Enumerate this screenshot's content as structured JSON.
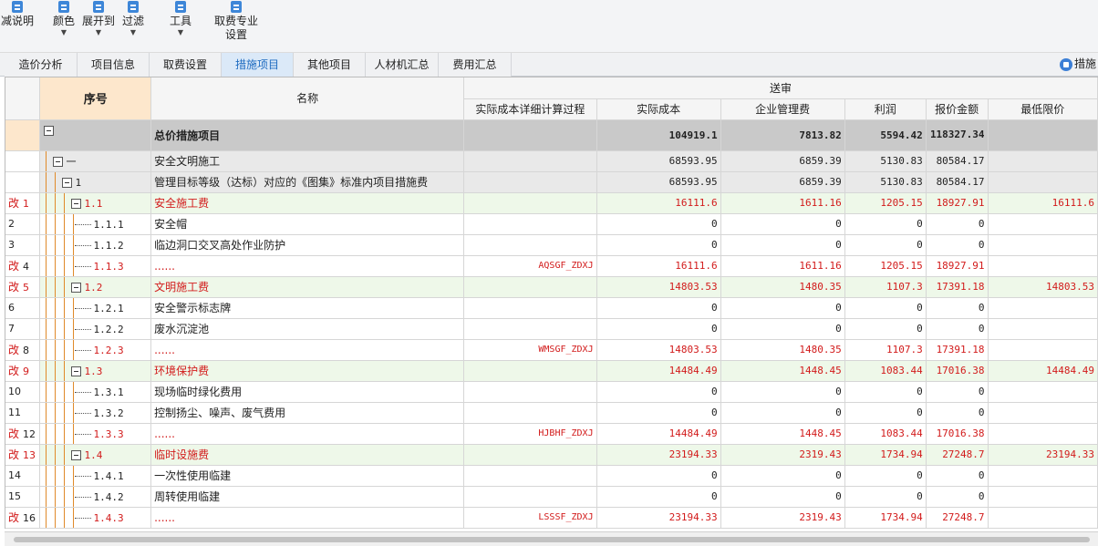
{
  "toolbar": {
    "items": [
      {
        "label": "减说明",
        "icon": "list-icon",
        "caret": false
      },
      {
        "label": "颜色",
        "icon": "paint-icon",
        "caret": true
      },
      {
        "label": "展开到",
        "icon": "expand-icon",
        "caret": true
      },
      {
        "label": "过滤",
        "icon": "filter-icon",
        "caret": true
      },
      {
        "label": "工具",
        "icon": "tool-icon",
        "caret": true
      },
      {
        "label": "取费专业\n设置",
        "icon": "fee-settings-icon",
        "caret": false
      }
    ]
  },
  "tabs": [
    "造价分析",
    "项目信息",
    "取费设置",
    "措施项目",
    "其他项目",
    "人材机汇总",
    "费用汇总"
  ],
  "active_tab": "措施项目",
  "tab_right_label": "措施",
  "grid": {
    "headers": {
      "seq": "序号",
      "name": "名称",
      "group": "送审",
      "cols": [
        "实际成本详细计算过程",
        "实际成本",
        "企业管理费",
        "利润",
        "报价金额",
        "最低限价"
      ]
    },
    "change_mark": "改",
    "rows": [
      {
        "rn": "",
        "seq": "",
        "name": "总价措施项目",
        "code": "",
        "cost": "104919.1",
        "mgmt": "7813.82",
        "profit": "5594.42",
        "quote": "118327.34",
        "min": "",
        "kind": "lv0",
        "depth": 0,
        "changed": false
      },
      {
        "rn": "",
        "seq": "一",
        "name": "安全文明施工",
        "code": "",
        "cost": "68593.95",
        "mgmt": "6859.39",
        "profit": "5130.83",
        "quote": "80584.17",
        "min": "",
        "kind": "lv1",
        "depth": 1,
        "changed": false
      },
      {
        "rn": "",
        "seq": "1",
        "name": "管理目标等级（达标）对应的《图集》标准内项目措施费",
        "code": "",
        "cost": "68593.95",
        "mgmt": "6859.39",
        "profit": "5130.83",
        "quote": "80584.17",
        "min": "",
        "kind": "lv2",
        "depth": 2,
        "changed": false
      },
      {
        "rn": "1",
        "seq": "1.1",
        "name": "安全施工费",
        "code": "",
        "cost": "16111.6",
        "mgmt": "1611.16",
        "profit": "1205.15",
        "quote": "18927.91",
        "min": "16111.6",
        "kind": "grp",
        "depth": 3,
        "changed": true
      },
      {
        "rn": "2",
        "seq": "1.1.1",
        "name": "安全帽",
        "code": "",
        "cost": "0",
        "mgmt": "0",
        "profit": "0",
        "quote": "0",
        "min": "",
        "kind": "leaf",
        "depth": 4,
        "changed": false
      },
      {
        "rn": "3",
        "seq": "1.1.2",
        "name": "临边洞口交叉高处作业防护",
        "code": "",
        "cost": "0",
        "mgmt": "0",
        "profit": "0",
        "quote": "0",
        "min": "",
        "kind": "leaf",
        "depth": 4,
        "changed": false
      },
      {
        "rn": "4",
        "seq": "1.1.3",
        "name": "......",
        "code": "AQSGF_ZDXJ",
        "cost": "16111.6",
        "mgmt": "1611.16",
        "profit": "1205.15",
        "quote": "18927.91",
        "min": "",
        "kind": "leaf",
        "depth": 4,
        "changed": true
      },
      {
        "rn": "5",
        "seq": "1.2",
        "name": "文明施工费",
        "code": "",
        "cost": "14803.53",
        "mgmt": "1480.35",
        "profit": "1107.3",
        "quote": "17391.18",
        "min": "14803.53",
        "kind": "grp",
        "depth": 3,
        "changed": true
      },
      {
        "rn": "6",
        "seq": "1.2.1",
        "name": "安全警示标志牌",
        "code": "",
        "cost": "0",
        "mgmt": "0",
        "profit": "0",
        "quote": "0",
        "min": "",
        "kind": "leaf",
        "depth": 4,
        "changed": false
      },
      {
        "rn": "7",
        "seq": "1.2.2",
        "name": "废水沉淀池",
        "code": "",
        "cost": "0",
        "mgmt": "0",
        "profit": "0",
        "quote": "0",
        "min": "",
        "kind": "leaf",
        "depth": 4,
        "changed": false
      },
      {
        "rn": "8",
        "seq": "1.2.3",
        "name": "......",
        "code": "WMSGF_ZDXJ",
        "cost": "14803.53",
        "mgmt": "1480.35",
        "profit": "1107.3",
        "quote": "17391.18",
        "min": "",
        "kind": "leaf",
        "depth": 4,
        "changed": true
      },
      {
        "rn": "9",
        "seq": "1.3",
        "name": "环境保护费",
        "code": "",
        "cost": "14484.49",
        "mgmt": "1448.45",
        "profit": "1083.44",
        "quote": "17016.38",
        "min": "14484.49",
        "kind": "grp",
        "depth": 3,
        "changed": true
      },
      {
        "rn": "10",
        "seq": "1.3.1",
        "name": "现场临时绿化费用",
        "code": "",
        "cost": "0",
        "mgmt": "0",
        "profit": "0",
        "quote": "0",
        "min": "",
        "kind": "leaf",
        "depth": 4,
        "changed": false
      },
      {
        "rn": "11",
        "seq": "1.3.2",
        "name": "控制扬尘、噪声、废气费用",
        "code": "",
        "cost": "0",
        "mgmt": "0",
        "profit": "0",
        "quote": "0",
        "min": "",
        "kind": "leaf",
        "depth": 4,
        "changed": false
      },
      {
        "rn": "12",
        "seq": "1.3.3",
        "name": "......",
        "code": "HJBHF_ZDXJ",
        "cost": "14484.49",
        "mgmt": "1448.45",
        "profit": "1083.44",
        "quote": "17016.38",
        "min": "",
        "kind": "leaf",
        "depth": 4,
        "changed": true
      },
      {
        "rn": "13",
        "seq": "1.4",
        "name": "临时设施费",
        "code": "",
        "cost": "23194.33",
        "mgmt": "2319.43",
        "profit": "1734.94",
        "quote": "27248.7",
        "min": "23194.33",
        "kind": "grp",
        "depth": 3,
        "changed": true
      },
      {
        "rn": "14",
        "seq": "1.4.1",
        "name": "一次性使用临建",
        "code": "",
        "cost": "0",
        "mgmt": "0",
        "profit": "0",
        "quote": "0",
        "min": "",
        "kind": "leaf",
        "depth": 4,
        "changed": false
      },
      {
        "rn": "15",
        "seq": "1.4.2",
        "name": "周转使用临建",
        "code": "",
        "cost": "0",
        "mgmt": "0",
        "profit": "0",
        "quote": "0",
        "min": "",
        "kind": "leaf",
        "depth": 4,
        "changed": false
      },
      {
        "rn": "16",
        "seq": "1.4.3",
        "name": "......",
        "code": "LSSSF_ZDXJ",
        "cost": "23194.33",
        "mgmt": "2319.43",
        "profit": "1734.94",
        "quote": "27248.7",
        "min": "",
        "kind": "leaf",
        "depth": 4,
        "changed": true
      }
    ]
  }
}
